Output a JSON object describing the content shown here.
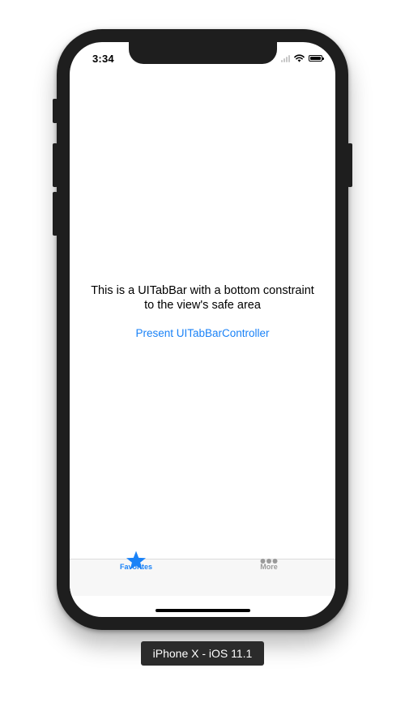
{
  "status_bar": {
    "time": "3:34"
  },
  "screen": {
    "message_line1": "This is a UITabBar with a bottom constraint",
    "message_line2": "to the view's safe area",
    "present_button_label": "Present UITabBarController"
  },
  "tab_bar": {
    "items": [
      {
        "label": "Favorites",
        "icon": "star-icon",
        "selected": true
      },
      {
        "label": "More",
        "icon": "more-dots-icon",
        "selected": false
      }
    ]
  },
  "device": {
    "label": "iPhone X - iOS 11.1"
  },
  "colors": {
    "accent": "#1a82f7",
    "inactive_tab": "#9a9a9a",
    "tab_bar_background": "#f7f7f7",
    "device_frame": "#1e1e1e"
  }
}
